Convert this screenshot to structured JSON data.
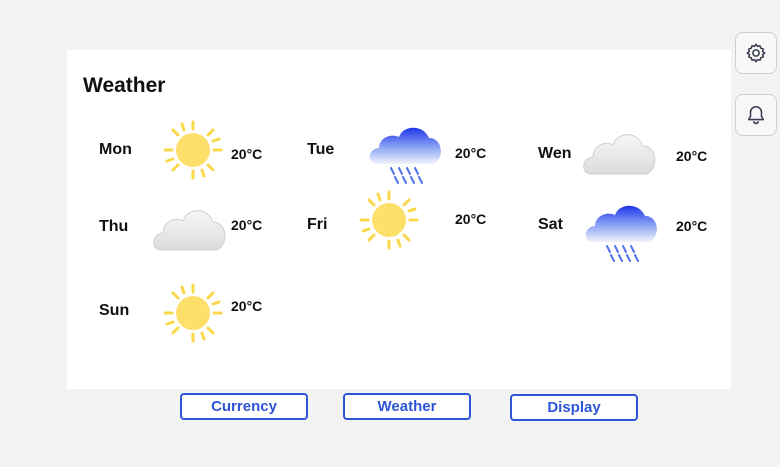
{
  "panel": {
    "title": "Weather"
  },
  "forecast": [
    {
      "day": "Mon",
      "temp": "20°C",
      "condition": "sun-icon"
    },
    {
      "day": "Tue",
      "temp": "20°C",
      "condition": "rain-cloud-icon"
    },
    {
      "day": "Wen",
      "temp": "20°C",
      "condition": "cloud-icon"
    },
    {
      "day": "Thu",
      "temp": "20°C",
      "condition": "cloud-icon"
    },
    {
      "day": "Fri",
      "temp": "20°C",
      "condition": "sun-icon"
    },
    {
      "day": "Sat",
      "temp": "20°C",
      "condition": "rain-cloud-icon"
    },
    {
      "day": "Sun",
      "temp": "20°C",
      "condition": "sun-icon"
    }
  ],
  "side_buttons": [
    {
      "icon": "gear-icon"
    },
    {
      "icon": "bell-icon"
    }
  ],
  "tabs": [
    {
      "label": "Currency"
    },
    {
      "label": "Weather"
    },
    {
      "label": "Display"
    }
  ],
  "colors": {
    "accent": "#2d55d6",
    "sun": "#fde06a",
    "rain_cloud": "#2440e0",
    "cloud": "#e6e6e6"
  }
}
